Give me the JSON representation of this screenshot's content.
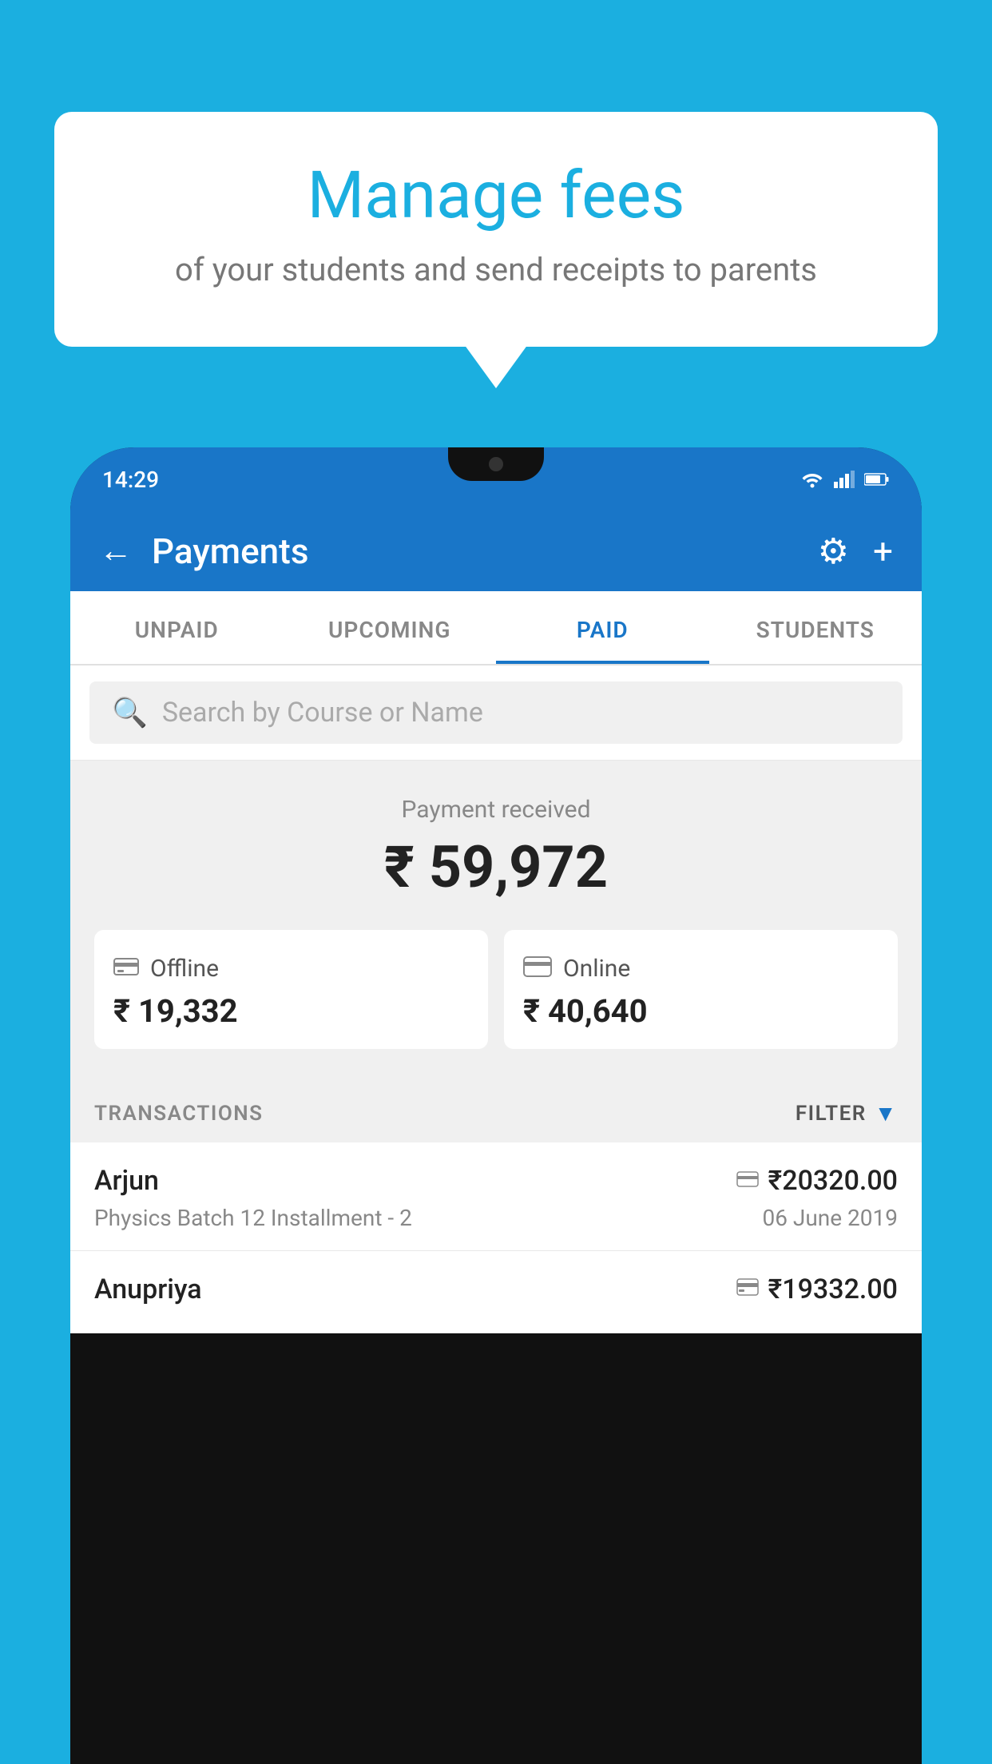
{
  "background_color": "#1BAFE0",
  "bubble": {
    "title": "Manage fees",
    "subtitle": "of your students and send receipts to parents"
  },
  "phone": {
    "status_time": "14:29",
    "header": {
      "title": "Payments",
      "back_label": "←",
      "settings_label": "⚙",
      "add_label": "+"
    },
    "tabs": [
      {
        "label": "UNPAID",
        "active": false
      },
      {
        "label": "UPCOMING",
        "active": false
      },
      {
        "label": "PAID",
        "active": true
      },
      {
        "label": "STUDENTS",
        "active": false
      }
    ],
    "search": {
      "placeholder": "Search by Course or Name"
    },
    "payment_summary": {
      "label": "Payment received",
      "total": "₹ 59,972",
      "offline_label": "Offline",
      "offline_amount": "₹ 19,332",
      "online_label": "Online",
      "online_amount": "₹ 40,640"
    },
    "transactions_header": {
      "label": "TRANSACTIONS",
      "filter_label": "FILTER"
    },
    "transactions": [
      {
        "name": "Arjun",
        "amount": "₹20320.00",
        "course": "Physics Batch 12 Installment - 2",
        "date": "06 June 2019",
        "payment_type": "online"
      },
      {
        "name": "Anupriya",
        "amount": "₹19332.00",
        "course": "",
        "date": "",
        "payment_type": "offline"
      }
    ]
  }
}
